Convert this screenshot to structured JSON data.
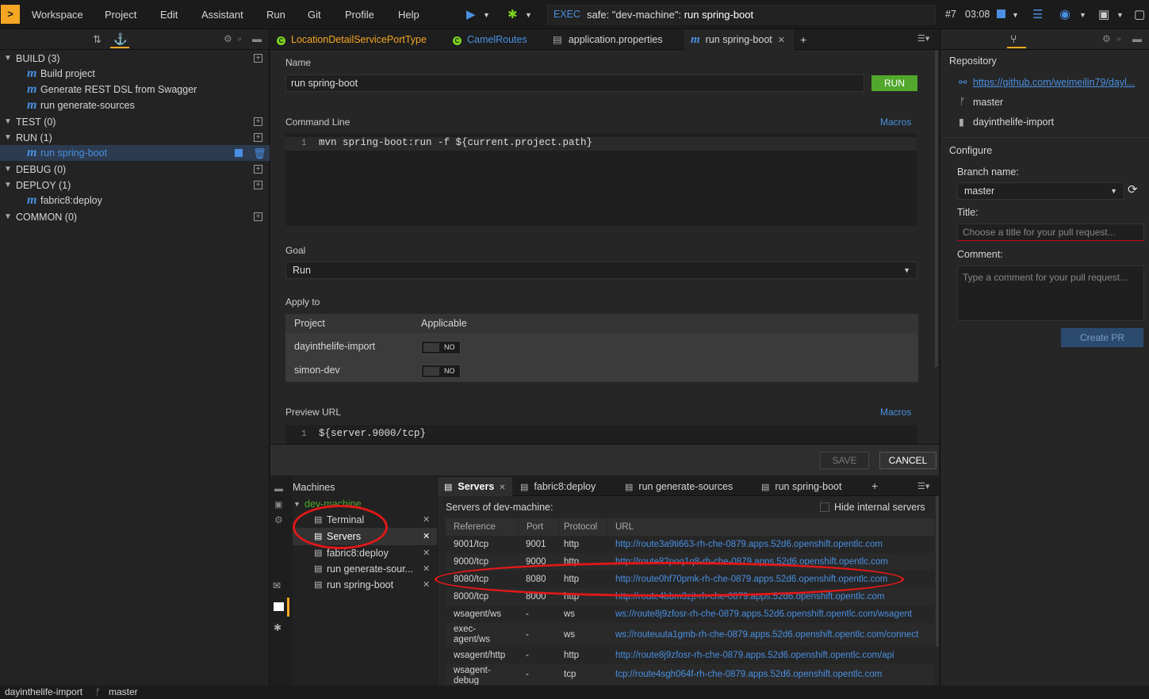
{
  "menubar": {
    "items": [
      "Workspace",
      "Project",
      "Edit",
      "Assistant",
      "Run",
      "Git",
      "Profile",
      "Help"
    ],
    "exec_label": "EXEC",
    "exec_prefix": "safe: \"dev-machine\": ",
    "exec_command": "run spring-boot",
    "build_num": "#7",
    "time": "03:08"
  },
  "commands": {
    "groups": [
      {
        "label": "BUILD (3)",
        "items": [
          "Build project",
          "Generate REST DSL from Swagger",
          "run generate-sources"
        ]
      },
      {
        "label": "TEST (0)",
        "items": []
      },
      {
        "label": "RUN (1)",
        "items": [
          "run spring-boot"
        ]
      },
      {
        "label": "DEBUG (0)",
        "items": []
      },
      {
        "label": "DEPLOY (1)",
        "items": [
          "fabric8:deploy"
        ]
      },
      {
        "label": "COMMON (0)",
        "items": []
      }
    ]
  },
  "editor_tabs": [
    "LocationDetailServicePortType",
    "CamelRoutes",
    "application.properties",
    "run spring-boot"
  ],
  "editor": {
    "name_label": "Name",
    "name_value": "run spring-boot",
    "run_button": "RUN",
    "cmdline_label": "Command Line",
    "macros": "Macros",
    "line1": "1",
    "cmdline_code": "mvn spring-boot:run -f ${current.project.path}",
    "goal_label": "Goal",
    "goal_value": "Run",
    "apply_label": "Apply to",
    "apply_col_project": "Project",
    "apply_col_applicable": "Applicable",
    "projects": [
      {
        "name": "dayinthelife-import",
        "toggle": "NO"
      },
      {
        "name": "simon-dev",
        "toggle": "NO"
      }
    ],
    "preview_label": "Preview URL",
    "preview_code": "${server.9000/tcp}",
    "save": "SAVE",
    "cancel": "CANCEL"
  },
  "git": {
    "repository_label": "Repository",
    "repo_url": "https://github.com/weimeilin79/dayl...",
    "branch": "master",
    "project": "dayinthelife-import",
    "configure_label": "Configure",
    "branch_name_label": "Branch name:",
    "branch_value": "master",
    "title_label": "Title:",
    "title_placeholder": "Choose a title for your pull request...",
    "comment_label": "Comment:",
    "comment_placeholder": "Type a comment for your pull request...",
    "create_pr": "Create PR"
  },
  "machines": {
    "title": "Machines",
    "machine": "dev-machine",
    "items": [
      "Terminal",
      "Servers",
      "fabric8:deploy",
      "run generate-sour...",
      "run spring-boot"
    ]
  },
  "bottom_tabs": [
    "Servers",
    "fabric8:deploy",
    "run generate-sources",
    "run spring-boot"
  ],
  "servers": {
    "title": "Servers of dev-machine:",
    "hide_internal": "Hide internal servers",
    "columns": [
      "Reference",
      "Port",
      "Protocol",
      "URL"
    ],
    "rows": [
      {
        "ref": "9001/tcp",
        "port": "9001",
        "proto": "http",
        "url": "http://route3a9ti663-rh-che-0879.apps.52d6.openshift.opentlc.com"
      },
      {
        "ref": "9000/tcp",
        "port": "9000",
        "proto": "http",
        "url": "http://route82poq1q8-rh-che-0879.apps.52d6.openshift.opentlc.com"
      },
      {
        "ref": "8080/tcp",
        "port": "8080",
        "proto": "http",
        "url": "http://route0hf70pmk-rh-che-0879.apps.52d6.openshift.opentlc.com"
      },
      {
        "ref": "8000/tcp",
        "port": "8000",
        "proto": "http",
        "url": "http://route4bbm3zjt-rh-che-0879.apps.52d6.openshift.opentlc.com"
      },
      {
        "ref": "wsagent/ws",
        "port": "-",
        "proto": "ws",
        "url": "ws://route8j9zfosr-rh-che-0879.apps.52d6.openshift.opentlc.com/wsagent"
      },
      {
        "ref": "exec-agent/ws",
        "port": "-",
        "proto": "ws",
        "url": "ws://routeuuta1gmb-rh-che-0879.apps.52d6.openshift.opentlc.com/connect"
      },
      {
        "ref": "wsagent/http",
        "port": "-",
        "proto": "http",
        "url": "http://route8j9zfosr-rh-che-0879.apps.52d6.openshift.opentlc.com/api"
      },
      {
        "ref": "wsagent-debug",
        "port": "-",
        "proto": "tcp",
        "url": "tcp://route4sgh064f-rh-che-0879.apps.52d6.openshift.opentlc.com"
      }
    ]
  },
  "statusbar": {
    "project": "dayinthelife-import",
    "branch": "master"
  },
  "colors": {
    "accent": "#4a90e2",
    "run": "#52a82c",
    "logo": "#f5a623",
    "annotation": "#e01818"
  }
}
